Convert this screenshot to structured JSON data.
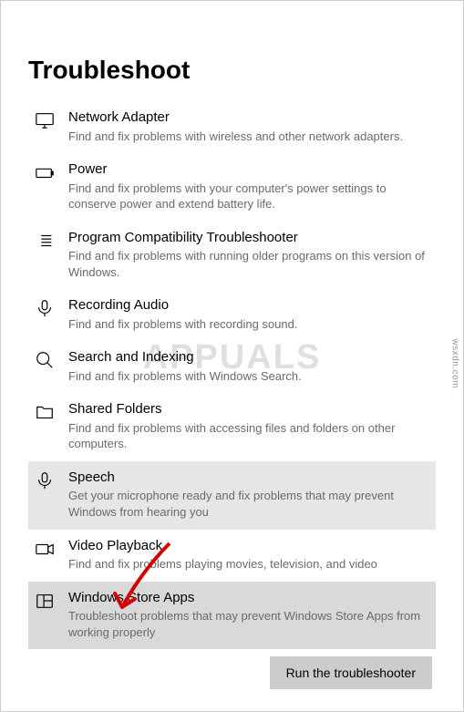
{
  "page": {
    "title": "Troubleshoot",
    "watermark": "APPUALS",
    "source": "wsxdn.com"
  },
  "items": [
    {
      "id": "network-adapter",
      "icon": "monitor-icon",
      "title": "Network Adapter",
      "desc": "Find and fix problems with wireless and other network adapters.",
      "state": "normal"
    },
    {
      "id": "power",
      "icon": "battery-icon",
      "title": "Power",
      "desc": "Find and fix problems with your computer's power settings to conserve power and extend battery life.",
      "state": "normal"
    },
    {
      "id": "program-compatibility",
      "icon": "list-icon",
      "title": "Program Compatibility Troubleshooter",
      "desc": "Find and fix problems with running older programs on this version of Windows.",
      "state": "normal"
    },
    {
      "id": "recording-audio",
      "icon": "microphone-icon",
      "title": "Recording Audio",
      "desc": "Find and fix problems with recording sound.",
      "state": "normal"
    },
    {
      "id": "search-indexing",
      "icon": "search-icon",
      "title": "Search and Indexing",
      "desc": "Find and fix problems with Windows Search.",
      "state": "normal"
    },
    {
      "id": "shared-folders",
      "icon": "folder-icon",
      "title": "Shared Folders",
      "desc": "Find and fix problems with accessing files and folders on other computers.",
      "state": "normal"
    },
    {
      "id": "speech",
      "icon": "microphone-icon",
      "title": "Speech",
      "desc": "Get your microphone ready and fix problems that may prevent Windows from hearing you",
      "state": "selected"
    },
    {
      "id": "video-playback",
      "icon": "video-icon",
      "title": "Video Playback",
      "desc": "Find and fix problems playing movies, television, and video",
      "state": "normal"
    },
    {
      "id": "windows-store-apps",
      "icon": "store-icon",
      "title": "Windows Store Apps",
      "desc": "Troubleshoot problems that may prevent Windows Store Apps from working properly",
      "state": "highlighted"
    }
  ],
  "button": {
    "run": "Run the troubleshooter"
  }
}
